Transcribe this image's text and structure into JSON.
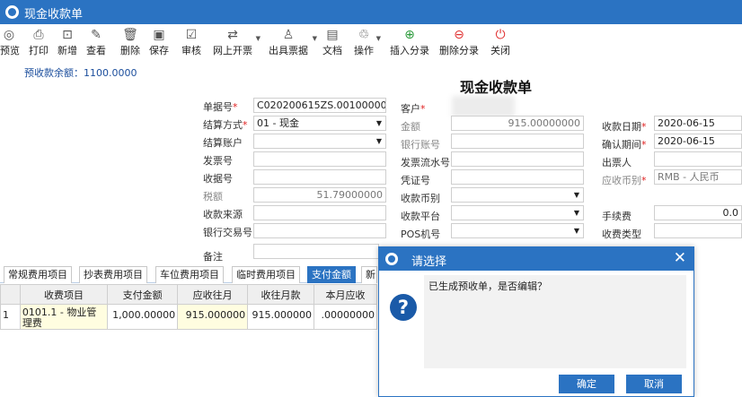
{
  "window": {
    "title": "现金收款单"
  },
  "toolbar": [
    {
      "name": "preview",
      "label": "预览",
      "icon": "◎"
    },
    {
      "name": "print",
      "label": "打印",
      "icon": "⎙"
    },
    {
      "name": "new",
      "label": "新增",
      "icon": "⊡"
    },
    {
      "name": "view",
      "label": "查看",
      "icon": "✎"
    },
    {
      "name": "delete",
      "label": "删除",
      "icon": "🗑"
    },
    {
      "name": "save",
      "label": "保存",
      "icon": "▣"
    },
    {
      "name": "audit",
      "label": "审核",
      "icon": "☑"
    },
    {
      "name": "online-invoice",
      "label": "网上开票",
      "icon": "⇄"
    },
    {
      "name": "issue-bill",
      "label": "出具票据",
      "icon": "♙"
    },
    {
      "name": "document",
      "label": "文档",
      "icon": "▤"
    },
    {
      "name": "operation",
      "label": "操作",
      "icon": "♲"
    },
    {
      "name": "insert-entry",
      "label": "插入分录",
      "icon": "⊕"
    },
    {
      "name": "delete-entry",
      "label": "删除分录",
      "icon": "⊖"
    },
    {
      "name": "close",
      "label": "关闭",
      "icon": "⏻"
    }
  ],
  "balance_label": "预收款余额：1100.0000",
  "form_title": "现金收款单",
  "form": {
    "doc_no": {
      "label": "单据号",
      "value": "C020200615ZS.00100000"
    },
    "customer": {
      "label": "客户"
    },
    "settle_method": {
      "label": "结算方式",
      "value": "01 - 现金"
    },
    "amount": {
      "label": "金额",
      "value": "915.00000000"
    },
    "receipt_date": {
      "label": "收款日期",
      "value": "2020-06-15"
    },
    "settle_account": {
      "label": "结算账户",
      "value": ""
    },
    "bank_account": {
      "label": "银行账号",
      "value": ""
    },
    "confirm_period": {
      "label": "确认期间",
      "value": "2020-06-15"
    },
    "invoice_no": {
      "label": "发票号",
      "value": ""
    },
    "invoice_serial": {
      "label": "发票流水号",
      "value": ""
    },
    "drawer": {
      "label": "出票人",
      "value": ""
    },
    "receipt_no": {
      "label": "收据号",
      "value": ""
    },
    "voucher_no": {
      "label": "凭证号",
      "value": ""
    },
    "ar_currency": {
      "label": "应收币别",
      "value": "RMB - 人民币"
    },
    "tax": {
      "label": "税额",
      "value": "51.79000000"
    },
    "receipt_currency": {
      "label": "收款币别",
      "value": ""
    },
    "source": {
      "label": "收款来源",
      "value": ""
    },
    "platform": {
      "label": "收款平台",
      "value": ""
    },
    "fee": {
      "label": "手续费",
      "value": "0.0"
    },
    "bank_txn_no": {
      "label": "银行交易号",
      "value": ""
    },
    "pos_no": {
      "label": "POS机号",
      "value": ""
    },
    "fee_type": {
      "label": "收费类型",
      "value": ""
    },
    "remark": {
      "label": "备注",
      "value": ""
    }
  },
  "tabs": [
    "常规费用项目",
    "抄表费用项目",
    "车位费用项目",
    "临时费用项目",
    "支付金额",
    "新"
  ],
  "grid": {
    "headers": [
      "",
      "收费项目",
      "支付金额",
      "应收往月",
      "收往月款",
      "本月应收"
    ],
    "rows": [
      [
        "1",
        "0101.1 - 物业管理费",
        "1,000.00000",
        "915.000000",
        "915.000000",
        ".00000000"
      ]
    ]
  },
  "dialog": {
    "title": "请选择",
    "message": "已生成预收单，是否编辑？",
    "ok": "确定",
    "cancel": "取消"
  }
}
